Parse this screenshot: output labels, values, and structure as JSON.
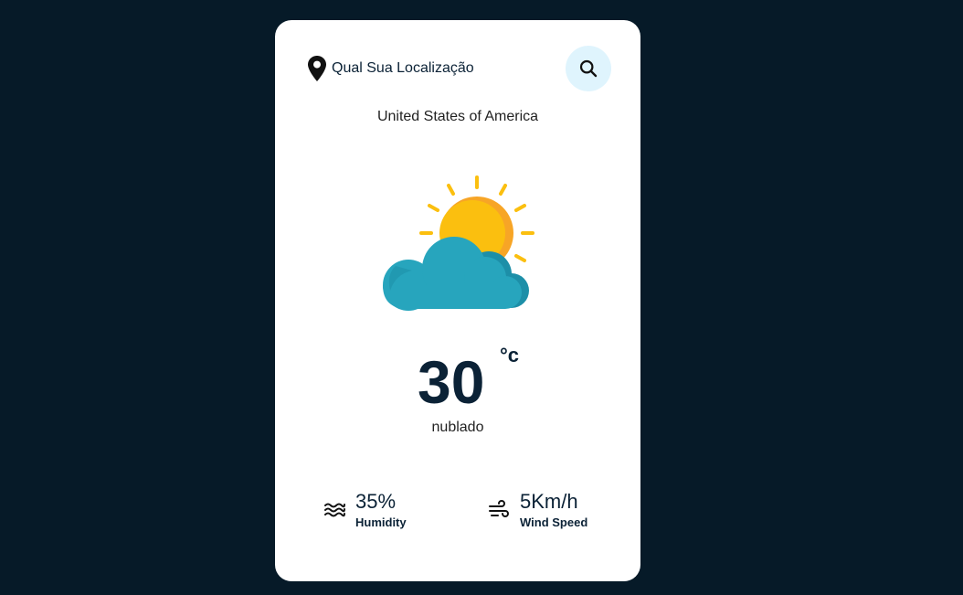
{
  "search": {
    "placeholder": "Qual Sua Localização",
    "button_icon": "search-icon",
    "location_icon": "map-pin-icon"
  },
  "location": {
    "country": "United States of America"
  },
  "weather": {
    "icon": "partly-cloudy-icon",
    "temperature": "30",
    "unit": "°c",
    "condition": "nublado"
  },
  "details": {
    "humidity": {
      "value": "35%",
      "label": "Humidity",
      "icon": "humidity-waves-icon"
    },
    "wind": {
      "value": "5Km/h",
      "label": "Wind Speed",
      "icon": "wind-icon"
    }
  },
  "colors": {
    "background": "#061a28",
    "card": "#ffffff",
    "text_dark": "#0b2236",
    "search_button_bg": "#dff4fd",
    "sun": "#fbbf0f",
    "cloud": "#27a5bd"
  }
}
